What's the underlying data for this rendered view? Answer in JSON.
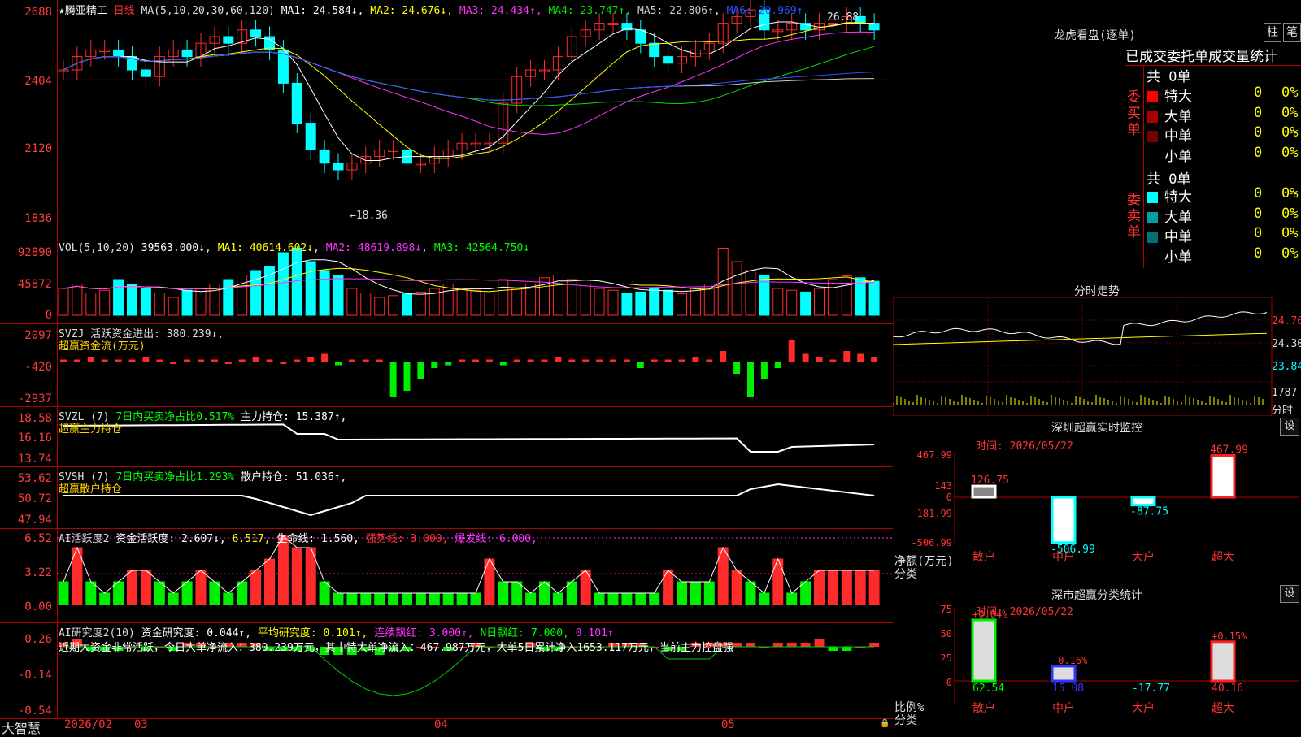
{
  "price": {
    "star": "★",
    "name": "腾亚精工",
    "period": "日线",
    "ma_params": "MA(5,10,20,30,60,120)",
    "ma": [
      {
        "label": "MA1:",
        "value": "24.584↓",
        "color": "#ffffff"
      },
      {
        "label": "MA2:",
        "value": "24.676↓",
        "color": "#ffff00"
      },
      {
        "label": "MA3:",
        "value": "24.434↑",
        "color": "#ff33ff"
      },
      {
        "label": "MA4:",
        "value": "23.747↑",
        "color": "#00e000"
      },
      {
        "label": "MA5:",
        "value": "22.806↑",
        "color": "#cccccc"
      },
      {
        "label": "MA6:",
        "value": "20.969↑",
        "color": "#3050ff"
      }
    ],
    "ticks": [
      "2688",
      "2404",
      "2120",
      "1836"
    ],
    "high_label": "26.88",
    "low_label": "←18.36"
  },
  "vol": {
    "header": "VOL(5,10,20)",
    "v1": "39563.000↓",
    "ma1": "MA1: 40614.602↓",
    "ma2": "MA2: 48619.898↓",
    "ma3": "MA3: 42564.750↓",
    "ticks": [
      "92890",
      "45872",
      "0"
    ]
  },
  "svzj": {
    "header": "SVZJ  活跃资金进出: 380.239↓,",
    "sub": "超赢资金流(万元)",
    "ticks": [
      "2097",
      "-420",
      "-2937"
    ]
  },
  "svzl": {
    "h1": "SVZL (7)",
    "h2": "7日内买卖净占比0.517%",
    "h3": "主力持仓: 15.387↑,",
    "sub": "超赢主力持仓",
    "ticks": [
      "18.58",
      "16.16",
      "13.74"
    ]
  },
  "svsh": {
    "h1": "SVSH (7)",
    "h2": "7日内买卖净占比1.293%",
    "h3": "散户持仓: 51.036↑,",
    "sub": "超赢散户持仓",
    "ticks": [
      "53.62",
      "50.72",
      "47.94"
    ]
  },
  "ai1": {
    "h1": "AI活跃度2",
    "h2": "资金活跃度: 2.607↓,",
    "h3": "6.517,",
    "h4": "生命线: 1.560,",
    "h5": "强势线: 3.000,",
    "h6": "爆发线: 6.000,",
    "ticks": [
      "6.52",
      "3.22",
      "0.00"
    ]
  },
  "ai2": {
    "h1": "AI研究度2(10)",
    "h2": "资金研究度: 0.044↑,",
    "h3": "平均研究度: 0.101↑,",
    "h4": "连续飘红: 3.000↑,",
    "h5": "N日飘红: 7.000,",
    "h6": "0.101↑",
    "comment": "近期大资金非常活跃，今日大单净流入：380.239万元，其中特大单净流入：467.987万元，大单5日累计净入1653.117万元，当前主力控盘强",
    "ticks": [
      "0.26",
      "-0.14",
      "-0.54"
    ]
  },
  "bottom": {
    "brand": "大智慧",
    "date": "2026/02",
    "m3": "03",
    "m4": "04",
    "m5": "05",
    "lock": "🔒"
  },
  "lh": {
    "title": "龙虎看盘(逐单)",
    "btn1": "柱",
    "btn2": "笔",
    "subtitle": "已成交委托单成交量统计",
    "buy_label": "委买单",
    "sell_label": "委卖单",
    "buy_total": "共 0单",
    "sell_total": "共 0单",
    "buy_rows": [
      {
        "name": "特大",
        "count": "0",
        "pct": "0%",
        "color": "#ff0000"
      },
      {
        "name": "大单",
        "count": "0",
        "pct": "0%",
        "color": "#aa0000"
      },
      {
        "name": "中单",
        "count": "0",
        "pct": "0%",
        "color": "#770000"
      },
      {
        "name": "小单",
        "count": "0",
        "pct": "0%",
        "color": "#000000"
      }
    ],
    "sell_rows": [
      {
        "name": "特大",
        "count": "0",
        "pct": "0%",
        "color": "#00ffff"
      },
      {
        "name": "大单",
        "count": "0",
        "pct": "0%",
        "color": "#00a0a0"
      },
      {
        "name": "中单",
        "count": "0",
        "pct": "0%",
        "color": "#007070"
      },
      {
        "name": "小单",
        "count": "0",
        "pct": "0%",
        "color": "#000000"
      }
    ]
  },
  "fenshi": {
    "title": "分时走势",
    "t1": "24.76",
    "t2": "24.30",
    "t3": "23.84",
    "v1": "1787",
    "v2": "分时"
  },
  "sz_monitor": {
    "title": "深圳超赢实时监控",
    "btn": "设",
    "time": "时间: 2026/05/22",
    "ticks": [
      "467.99",
      "143",
      "0",
      "-181.99",
      "-506.99"
    ],
    "ylabel": "净额(万元)",
    "xlabel": "分类",
    "cats": [
      "散户",
      "中户",
      "大户",
      "超大"
    ],
    "values": [
      126.75,
      -506.99,
      -87.75,
      467.99
    ],
    "value_labels": [
      "126.75",
      "-506.99",
      "-87.75",
      "467.99"
    ]
  },
  "sz_class": {
    "title": "深市超赢分类统计",
    "btn": "设",
    "time": "时间: 2026/05/22",
    "ticks": [
      "75",
      "50",
      "25",
      "0"
    ],
    "ylabel": "比例%",
    "xlabel": "分类",
    "cats": [
      "散户",
      "中户",
      "大户",
      "超大"
    ],
    "values": [
      62.54,
      15.08,
      -17.77,
      40.16
    ],
    "value_labels": [
      "62.54",
      "15.08",
      "-17.77",
      "40.16"
    ],
    "pct_labels": [
      "+0.04%",
      "-0.16%",
      "",
      "+0.15%"
    ]
  }
}
